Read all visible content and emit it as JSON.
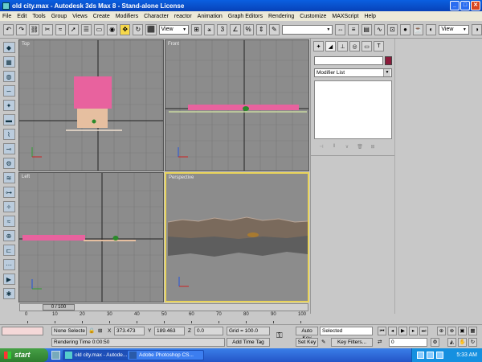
{
  "window": {
    "title": "old city.max - Autodesk 3ds Max 8 - Stand-alone License",
    "minimize": "_",
    "maximize": "□",
    "close": "✕"
  },
  "menu": [
    "File",
    "Edit",
    "Tools",
    "Group",
    "Views",
    "Create",
    "Modifiers",
    "Character",
    "reactor",
    "Animation",
    "Graph Editors",
    "Rendering",
    "Customize",
    "MAXScript",
    "Help"
  ],
  "toolbar": {
    "ref_coord": "View",
    "named_selection": "",
    "render_view": "View"
  },
  "viewports": {
    "top": "Top",
    "front": "Front",
    "left": "Left",
    "perspective": "Perspective"
  },
  "command_panel": {
    "modifier_list": "Modifier List",
    "swatch_color": "#8b1a3a"
  },
  "time": {
    "slider": "0 / 100",
    "ticks": [
      "0",
      "10",
      "20",
      "30",
      "40",
      "50",
      "60",
      "70",
      "80",
      "90",
      "100"
    ]
  },
  "status": {
    "selection": "None Selecte",
    "x_label": "X",
    "x_value": "373.473",
    "y_label": "Y",
    "y_value": "189.463",
    "z_label": "Z",
    "z_value": "0.0",
    "grid": "Grid = 100.0",
    "prompt": "Rendering Time  0:00:50",
    "add_time_tag": "Add Time Tag",
    "auto_key": "Auto Key",
    "set_key": "Set Key",
    "key_mode": "Selected",
    "key_filters": "Key Filters...",
    "frame": "0"
  },
  "taskbar": {
    "start": "start",
    "tasks": [
      "old city.max - Autode...",
      "Adobe Photoshop CS..."
    ],
    "clock": "5:33 AM"
  }
}
